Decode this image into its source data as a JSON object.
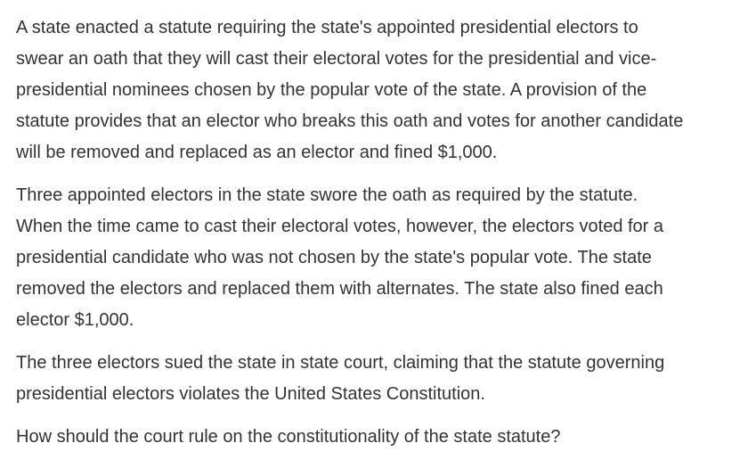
{
  "question": {
    "paragraphs": [
      "A state enacted a statute requiring the state's appointed presidential electors to\nswear an oath that they will cast their electoral votes for the presidential and vice-\npresidential nominees chosen by the popular vote of the state.  A provision of the\nstatute provides that an elector who breaks this oath and votes for another candidate\nwill be removed and replaced as an elector and fined $1,000.",
      "Three appointed electors in the state swore the oath as required by the statute.\nWhen the time came to cast their electoral votes, however, the electors voted for a\npresidential candidate who was not chosen by the state's popular vote.  The state\nremoved the electors and replaced them with alternates.  The state also fined each\nelector $1,000.",
      "The three electors sued the state in state court, claiming that the statute governing\npresidential electors violates the United States Constitution.",
      "How should the court rule on the constitutionality of the state statute?"
    ]
  }
}
